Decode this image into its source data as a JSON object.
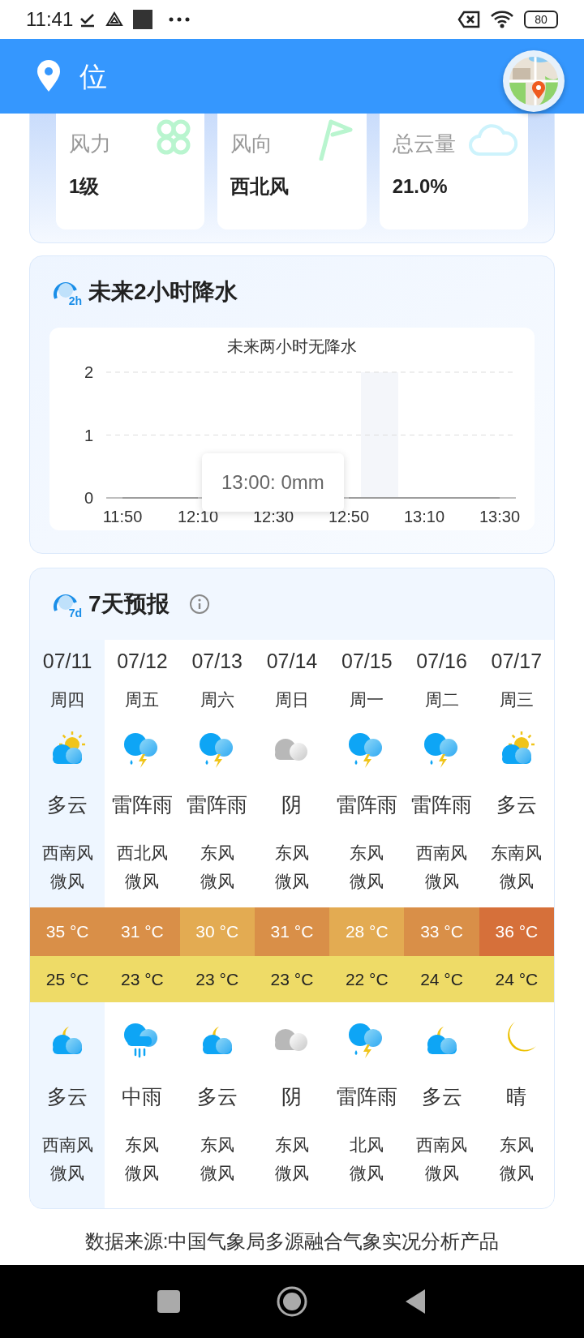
{
  "status_bar": {
    "time": "11:41",
    "battery": "80"
  },
  "header": {
    "location": "位"
  },
  "tiles": [
    {
      "label": "风力",
      "value": "1级",
      "kind": "fan"
    },
    {
      "label": "风向",
      "value": "西北风",
      "kind": "flag"
    },
    {
      "label": "总云量",
      "value": "21.0%",
      "kind": "cloud"
    }
  ],
  "precipitation": {
    "title": "未来2小时降水",
    "badge": "2h",
    "tooltip": "13:00: 0mm",
    "chart_data": {
      "type": "line",
      "title": "未来两小时无降水",
      "categories": [
        "11:50",
        "12:10",
        "12:30",
        "12:50",
        "13:10",
        "13:30"
      ],
      "series": [
        {
          "color": "#9e9e9e",
          "values": [
            0,
            0,
            null,
            0,
            0,
            0
          ]
        }
      ],
      "yticks": [
        0,
        1,
        2
      ],
      "ylim": [
        0,
        2
      ]
    }
  },
  "forecast": {
    "title": "7天预报",
    "badge": "7d",
    "days": [
      {
        "selected": true,
        "date": "07/11",
        "weekday": "周四",
        "day": {
          "kind": "partly_cloudy_day",
          "weather": "多云",
          "wind": "西南风",
          "level": "微风"
        },
        "high": {
          "text": "35 °C",
          "color": "#d98f48"
        },
        "low": "25 °C",
        "night": {
          "kind": "partly_cloudy_night",
          "weather": "多云",
          "wind": "西南风",
          "level": "微风"
        }
      },
      {
        "selected": false,
        "date": "07/12",
        "weekday": "周五",
        "day": {
          "kind": "thunder_shower",
          "weather": "雷阵雨",
          "wind": "西北风",
          "level": "微风"
        },
        "high": {
          "text": "31 °C",
          "color": "#d98f48"
        },
        "low": "23 °C",
        "night": {
          "kind": "rain",
          "weather": "中雨",
          "wind": "东风",
          "level": "微风"
        }
      },
      {
        "selected": false,
        "date": "07/13",
        "weekday": "周六",
        "day": {
          "kind": "thunder_shower",
          "weather": "雷阵雨",
          "wind": "东风",
          "level": "微风"
        },
        "high": {
          "text": "30 °C",
          "color": "#e3ab52"
        },
        "low": "23 °C",
        "night": {
          "kind": "partly_cloudy_night",
          "weather": "多云",
          "wind": "东风",
          "level": "微风"
        }
      },
      {
        "selected": false,
        "date": "07/14",
        "weekday": "周日",
        "day": {
          "kind": "overcast",
          "weather": "阴",
          "wind": "东风",
          "level": "微风"
        },
        "high": {
          "text": "31 °C",
          "color": "#d98f48"
        },
        "low": "23 °C",
        "night": {
          "kind": "overcast",
          "weather": "阴",
          "wind": "东风",
          "level": "微风"
        }
      },
      {
        "selected": false,
        "date": "07/15",
        "weekday": "周一",
        "day": {
          "kind": "thunder_shower",
          "weather": "雷阵雨",
          "wind": "东风",
          "level": "微风"
        },
        "high": {
          "text": "28 °C",
          "color": "#e3ab52"
        },
        "low": "22 °C",
        "night": {
          "kind": "thunder_shower",
          "weather": "雷阵雨",
          "wind": "北风",
          "level": "微风"
        }
      },
      {
        "selected": false,
        "date": "07/16",
        "weekday": "周二",
        "day": {
          "kind": "thunder_shower",
          "weather": "雷阵雨",
          "wind": "西南风",
          "level": "微风"
        },
        "high": {
          "text": "33 °C",
          "color": "#d98f48"
        },
        "low": "24 °C",
        "night": {
          "kind": "partly_cloudy_night",
          "weather": "多云",
          "wind": "西南风",
          "level": "微风"
        }
      },
      {
        "selected": false,
        "date": "07/17",
        "weekday": "周三",
        "day": {
          "kind": "partly_cloudy_day",
          "weather": "多云",
          "wind": "东南风",
          "level": "微风"
        },
        "high": {
          "text": "36 °C",
          "color": "#d6703a"
        },
        "low": "24 °C",
        "night": {
          "kind": "clear_night",
          "weather": "晴",
          "wind": "东风",
          "level": "微风"
        }
      }
    ]
  },
  "source": "数据来源:中国气象局多源融合气象实况分析产品"
}
